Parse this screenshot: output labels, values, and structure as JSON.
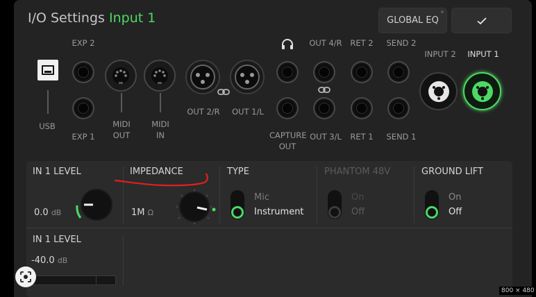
{
  "header": {
    "title": "I/O Settings",
    "title_accent": "Input 1",
    "global_eq_label": "GLOBAL EQ",
    "confirm_icon": "check-icon"
  },
  "io": {
    "exp2": "EXP 2",
    "exp1": "EXP 1",
    "usb": "USB",
    "midi_out": "MIDI\nOUT",
    "midi_in": "MIDI\nIN",
    "out2r": "OUT 2/R",
    "out1l": "OUT 1/L",
    "capture_out": "CAPTURE\nOUT",
    "out4r": "OUT 4/R",
    "out3l": "OUT 3/L",
    "ret2": "RET 2",
    "ret1": "RET 1",
    "send2": "SEND 2",
    "send1": "SEND 1",
    "input2": "INPUT 2",
    "input1": "INPUT 1",
    "headphone_icon": "headphone-icon",
    "link_icon": "link-icon"
  },
  "controls": {
    "level": {
      "title": "IN 1 LEVEL",
      "value": "0.0",
      "unit": "dB"
    },
    "impedance": {
      "title": "IMPEDANCE",
      "value": "1M",
      "unit": "Ω"
    },
    "type": {
      "title": "TYPE",
      "options": [
        "Mic",
        "Instrument"
      ],
      "selected": "Instrument"
    },
    "phantom": {
      "title": "PHANTOM 48V",
      "options": [
        "On",
        "Off"
      ],
      "selected": "Off",
      "disabled": true
    },
    "ground_lift": {
      "title": "GROUND LIFT",
      "options": [
        "On",
        "Off"
      ],
      "selected": "Off"
    }
  },
  "meter": {
    "title": "IN 1 LEVEL",
    "value": "-40.0",
    "unit": "dB"
  },
  "overlay": {
    "resolution": "800 × 480"
  },
  "colors": {
    "accent": "#4cd964",
    "annotation": "#e0201b"
  }
}
